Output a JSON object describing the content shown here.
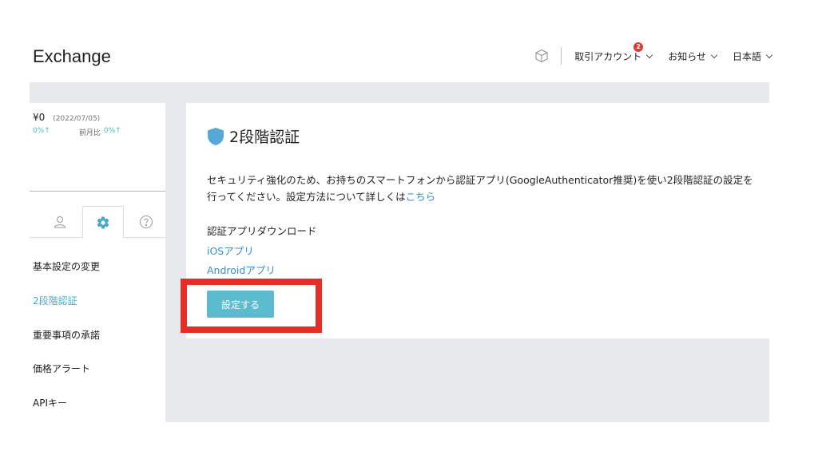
{
  "header": {
    "logo": "Exchange",
    "trading_account": "取引アカウント",
    "notification_badge": "2",
    "news": "お知らせ",
    "language": "日本語"
  },
  "balance": {
    "amount": "¥0",
    "date": "(2022/07/05)",
    "change_pct": "0%↑",
    "prev_label": "前月比",
    "prev_pct": "0%↑"
  },
  "sidebar": {
    "items": [
      {
        "label": "基本設定の変更"
      },
      {
        "label": "2段階認証"
      },
      {
        "label": "重要事項の承諾"
      },
      {
        "label": "価格アラート"
      },
      {
        "label": "APIキー"
      }
    ]
  },
  "main": {
    "title": "2段階認証",
    "description": "セキュリティ強化のため、お持ちのスマートフォンから認証アプリ(GoogleAuthenticator推奨)を使い2段階認証の設定を行ってください。設定方法について詳しくは",
    "description_link": "こちら",
    "download_title": "認証アプリダウンロード",
    "ios_link": "iOSアプリ",
    "android_link": "Androidアプリ",
    "setup_button": "設定する"
  },
  "colors": {
    "accent": "#5bbccd",
    "link": "#3a8fc4",
    "highlight": "#e52f26",
    "background_gray": "#e8e9ed"
  }
}
